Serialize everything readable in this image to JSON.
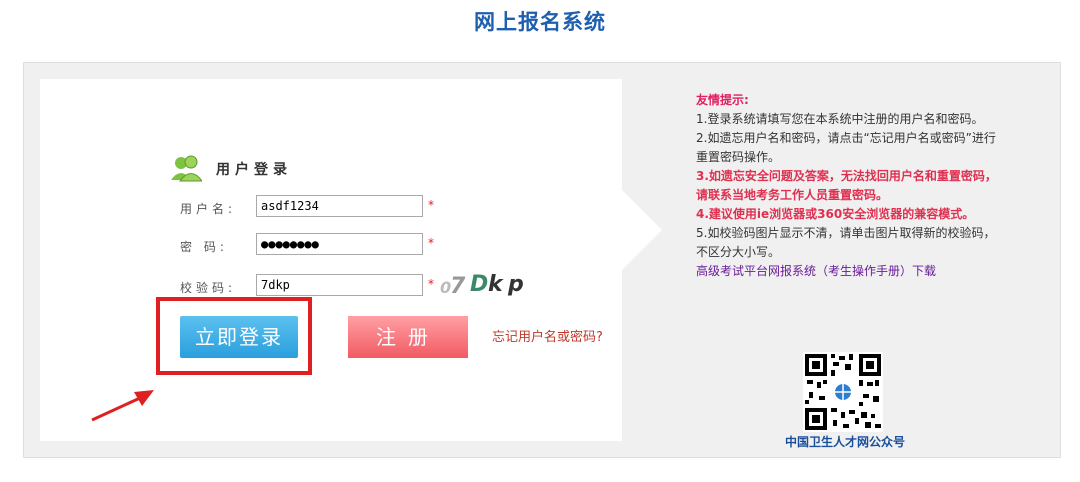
{
  "page": {
    "title": "网上报名系统"
  },
  "login": {
    "heading": "用户登录",
    "username_label": "用户名:",
    "username_value": "asdf1234",
    "password_label": "密 码:",
    "password_value": "●●●●●●●●",
    "captcha_label": "校验码:",
    "captcha_value": "7dkp",
    "required_mark": "*",
    "captcha_image_chars": [
      "0",
      "7",
      "D",
      "k",
      "p"
    ],
    "login_button": "立即登录",
    "register_button": "注册",
    "forgot_link": "忘记用户名或密码?"
  },
  "tips": {
    "title": "友情提示:",
    "item1": "1.登录系统请填写您在本系统中注册的用户名和密码。",
    "item2": "2.如遗忘用户名和密码，请点击“忘记用户名或密码”进行重置密码操作。",
    "item3": "3.如遗忘安全问题及答案，无法找回用户名和重置密码，请联系当地考务工作人员重置密码。",
    "item4": "4.建议使用ie浏览器或360安全浏览器的兼容模式。",
    "item5": "5.如校验码图片显示不清，请单击图片取得新的校验码，不区分大小写。",
    "manual_link": "高级考试平台网报系统（考生操作手册）下载"
  },
  "qr": {
    "caption": "中国卫生人才网公众号",
    "icon": "qr-code-icon"
  },
  "colors": {
    "title": "#1f5fb0",
    "login_button": "#2a9fdc",
    "register_button": "#f25b63",
    "highlight": "#e02020"
  }
}
